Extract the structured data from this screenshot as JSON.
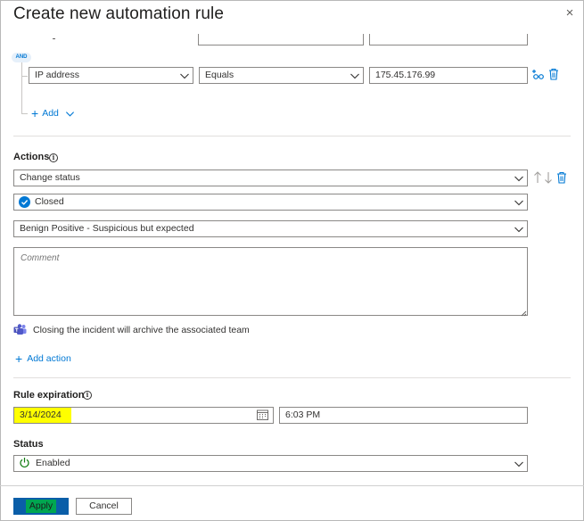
{
  "dialog": {
    "title": "Create new automation rule",
    "close_icon": "×"
  },
  "conditions": {
    "and_badge": "AND",
    "property_value": "IP address",
    "operator_value": "Equals",
    "value_text": "175.45.176.99",
    "add_label": "Add"
  },
  "actions": {
    "label": "Actions",
    "action_type": "Change status",
    "status_value": "Closed",
    "classification_value": "Benign Positive - Suspicious but expected",
    "comment_placeholder": "Comment",
    "teams_notice": "Closing the incident will archive the associated team",
    "add_action_label": "Add action"
  },
  "expiration": {
    "label": "Rule expiration",
    "date_value": "3/14/2024",
    "time_value": "6:03 PM"
  },
  "status": {
    "label": "Status",
    "value": "Enabled"
  },
  "footer": {
    "apply_label": "Apply",
    "cancel_label": "Cancel"
  },
  "colors": {
    "accent": "#0078d4",
    "highlight": "#ffff00",
    "apply_bg": "#0a5ea8",
    "apply_highlight": "#00a651"
  }
}
